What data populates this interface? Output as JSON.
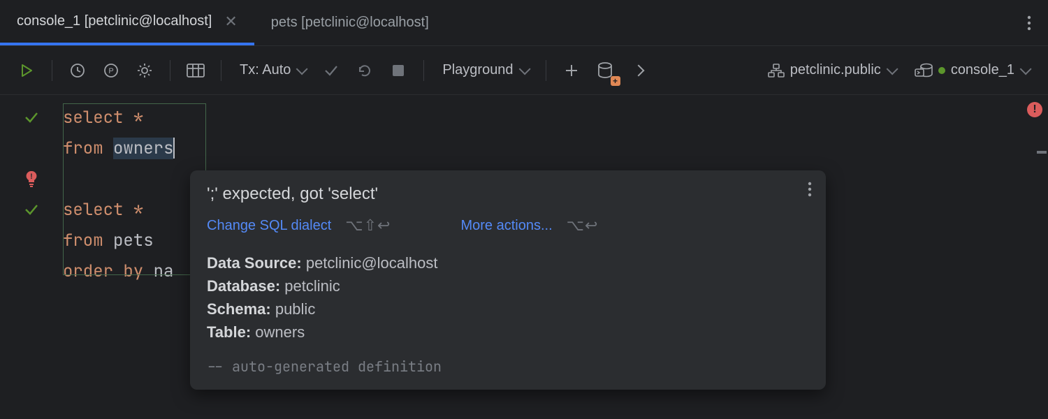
{
  "tabs": [
    {
      "label": "console_1 [petclinic@localhost]",
      "active": true
    },
    {
      "label": "pets [petclinic@localhost]",
      "active": false
    }
  ],
  "toolbar": {
    "tx_label": "Tx: Auto",
    "playground_label": "Playground",
    "schema_label": "petclinic.public",
    "console_label": "console_1"
  },
  "code": {
    "l1": {
      "kw": "select",
      "rest": " ",
      "star": "*"
    },
    "l2": {
      "kw": "from",
      "rest": " ",
      "ident": "owners"
    },
    "l4": {
      "kw": "select",
      "rest": " ",
      "star": "*"
    },
    "l5": {
      "kw": "from",
      "rest": " pets"
    },
    "l6": {
      "kw": "order by",
      "rest": " na"
    }
  },
  "popup": {
    "title": "';' expected, got 'select'",
    "action1": "Change SQL dialect",
    "shortcut1": "⌥⇧↩",
    "action2": "More actions...",
    "shortcut2": "⌥↩",
    "info": {
      "ds_label": "Data Source:",
      "ds_value": " petclinic@localhost",
      "db_label": "Database:",
      "db_value": " petclinic",
      "schema_label": "Schema:",
      "schema_value": " public",
      "table_label": "Table:",
      "table_value": " owners"
    },
    "comment": "-- auto-generated definition"
  }
}
